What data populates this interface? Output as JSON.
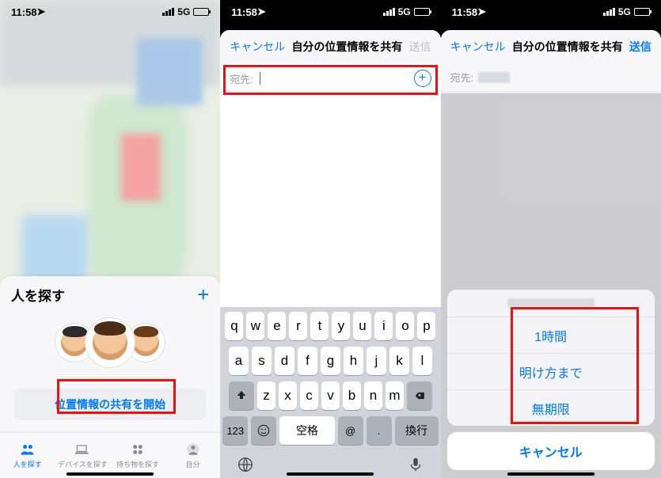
{
  "status": {
    "time": "11:58",
    "network": "5G"
  },
  "screen1": {
    "sheet_title": "人を探す",
    "start_share": "位置情報の共有を開始",
    "tabs": {
      "people": "人を探す",
      "devices": "デバイスを探す",
      "items": "持ち物を探す",
      "me": "自分"
    }
  },
  "screen2": {
    "cancel": "キャンセル",
    "title": "自分の位置情報を共有",
    "send": "送信",
    "to_label": "宛先:",
    "to_value": "",
    "keyboard": {
      "row1": [
        "q",
        "w",
        "e",
        "r",
        "t",
        "y",
        "u",
        "i",
        "o",
        "p"
      ],
      "row2": [
        "a",
        "s",
        "d",
        "f",
        "g",
        "h",
        "j",
        "k",
        "l"
      ],
      "row3_keys": [
        "z",
        "x",
        "c",
        "v",
        "b",
        "n",
        "m"
      ],
      "num_key": "123",
      "space": "空格",
      "return": "換行"
    }
  },
  "screen3": {
    "cancel": "キャンセル",
    "title": "自分の位置情報を共有",
    "send": "送信",
    "to_label": "宛先:",
    "options": {
      "one_hour": "1時間",
      "until_morning": "明け方まで",
      "forever": "無期限"
    },
    "sheet_cancel": "キャンセル"
  }
}
